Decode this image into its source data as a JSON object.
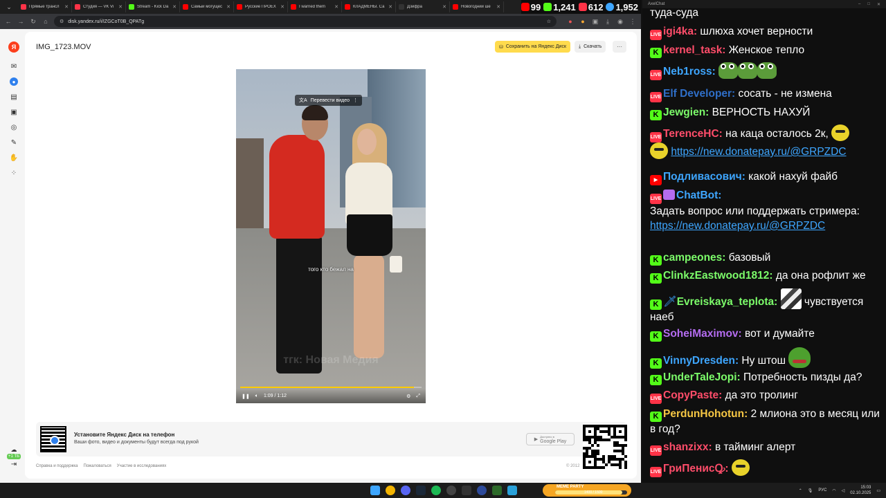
{
  "browser": {
    "tabs": [
      {
        "label": "Прямые трансл",
        "color": "#ff3347"
      },
      {
        "label": "Студия — VK Vi",
        "color": "#ff3347"
      },
      {
        "label": "Stream - Kick Da",
        "color": "#53fc18"
      },
      {
        "label": "Самый могущес",
        "color": "#ff0000"
      },
      {
        "label": "Русские ПРОЕХ",
        "color": "#ff0000"
      },
      {
        "label": "I warned them",
        "color": "#ff0000"
      },
      {
        "label": "КЛАДМЕНЫ. Са",
        "color": "#ff0000"
      },
      {
        "label": "Дзифра",
        "color": "#333333"
      },
      {
        "label": "Новогодний ше",
        "color": "#ff0000"
      }
    ],
    "url": "disk.yandex.ru/i/IZGCoT0B_QPATg"
  },
  "stream_stats": [
    {
      "value": "99",
      "sub": "",
      "color": "#ff0000"
    },
    {
      "value": "1,241",
      "sub": "",
      "color": "#53fc18"
    },
    {
      "value": "612",
      "sub": "",
      "color": "#ff3347"
    },
    {
      "value": "1,952",
      "sub": "",
      "color": "#3ea6ff"
    }
  ],
  "disk": {
    "file_name": "IMG_1723.MOV",
    "save_label": "Сохранить на Яндекс Диск",
    "download_label": "Скачать",
    "more_label": "···",
    "video": {
      "translate_label": "Перевести видео",
      "subtitle": "того кто бежал на",
      "watermark": "тгк: Новая Медия",
      "time": "1:09 / 1:12",
      "progress": 0.958
    },
    "promo": {
      "title": "Установите Яндекс Диск на телефон",
      "subtitle": "Ваши фото, видео и документы будут всегда под рукой",
      "store_small": "Доступно в",
      "store_label": "Google Play"
    },
    "footer": [
      "Справка и поддержка",
      "Пожаловаться",
      "Участие в исследованиях"
    ],
    "copyright": "© 2012",
    "storage_badge": "+1 ТБ"
  },
  "chat": {
    "window_title": "AxelChat",
    "messages": [
      {
        "platform": "none",
        "nick": "",
        "nick_color": "#ffffff",
        "text": "туда-суда"
      },
      {
        "platform": "vk",
        "nick": "igi4ka:",
        "nick_color": "#ff4d6a",
        "text": "шлюха хочет верности"
      },
      {
        "platform": "kick",
        "nick": "kernel_task:",
        "nick_color": "#ff4d6a",
        "text": "Женское тепло"
      },
      {
        "platform": "vk",
        "nick": "Neb1ross:",
        "nick_color": "#3ea6ff",
        "text": ""
      },
      {
        "platform": "vk",
        "nick": "Elf Developer:",
        "nick_color": "#2f6fc9",
        "text": "сосать - не измена"
      },
      {
        "platform": "kick",
        "nick": "Jewgien:",
        "nick_color": "#7cfc6a",
        "text": "ВЕРНОСТЬ НАХУЙ"
      },
      {
        "platform": "vk",
        "nick": "TerenceHC:",
        "nick_color": "#ff4d6a",
        "text": "на каца осталось 2к,",
        "link": "https://new.donatepay.ru/@GRPZDC"
      },
      {
        "platform": "yt",
        "nick": "Подливасович:",
        "nick_color": "#3ea6ff",
        "text": "какой нахуй файб"
      },
      {
        "platform": "vk",
        "nick": "ChatBot:",
        "nick_color": "#3ea6ff",
        "text": "Задать вопрос или поддержать стримера:",
        "link": "https://new.donatepay.ru/@GRPZDC"
      },
      {
        "platform": "kick",
        "nick": "campeones:",
        "nick_color": "#7cfc6a",
        "text": "базовый"
      },
      {
        "platform": "kick",
        "nick": "ClinkzEastwood1812:",
        "nick_color": "#7cfc6a",
        "text": "да она рофлит же"
      },
      {
        "platform": "kick",
        "nick": "Evreiskaya_teplota:",
        "nick_color": "#7cfc6a",
        "text": "чувствуется наеб"
      },
      {
        "platform": "kick",
        "nick": "SoheiMaximov:",
        "nick_color": "#b46cf0",
        "text": "вот и думайте"
      },
      {
        "platform": "kick",
        "nick": "VinnyDresden:",
        "nick_color": "#3ea6ff",
        "text": "Ну штош"
      },
      {
        "platform": "kick",
        "nick": "UnderTaleJopi:",
        "nick_color": "#7cfc6a",
        "text": "Потребность пизды да?"
      },
      {
        "platform": "vk",
        "nick": "CopyPaste:",
        "nick_color": "#ff4d6a",
        "text": "да это тролинг"
      },
      {
        "platform": "kick",
        "nick": "PerdunHohotun:",
        "nick_color": "#f6c744",
        "text": "2 млиона это в месяц или в год?"
      },
      {
        "platform": "vk",
        "nick": "shanzixx:",
        "nick_color": "#ff4d6a",
        "text": "в тайминг алерт"
      },
      {
        "platform": "vk",
        "nick": "ГриПенисꝘ:",
        "nick_color": "#ff4d6a",
        "text": ""
      }
    ]
  },
  "taskbar": {
    "meme_label": "MEME PARTY",
    "meme_value": "1400 / 1500",
    "meme_fill": 0.93,
    "lang": "РУС",
    "time": "15:03",
    "date": "02.10.2025"
  }
}
